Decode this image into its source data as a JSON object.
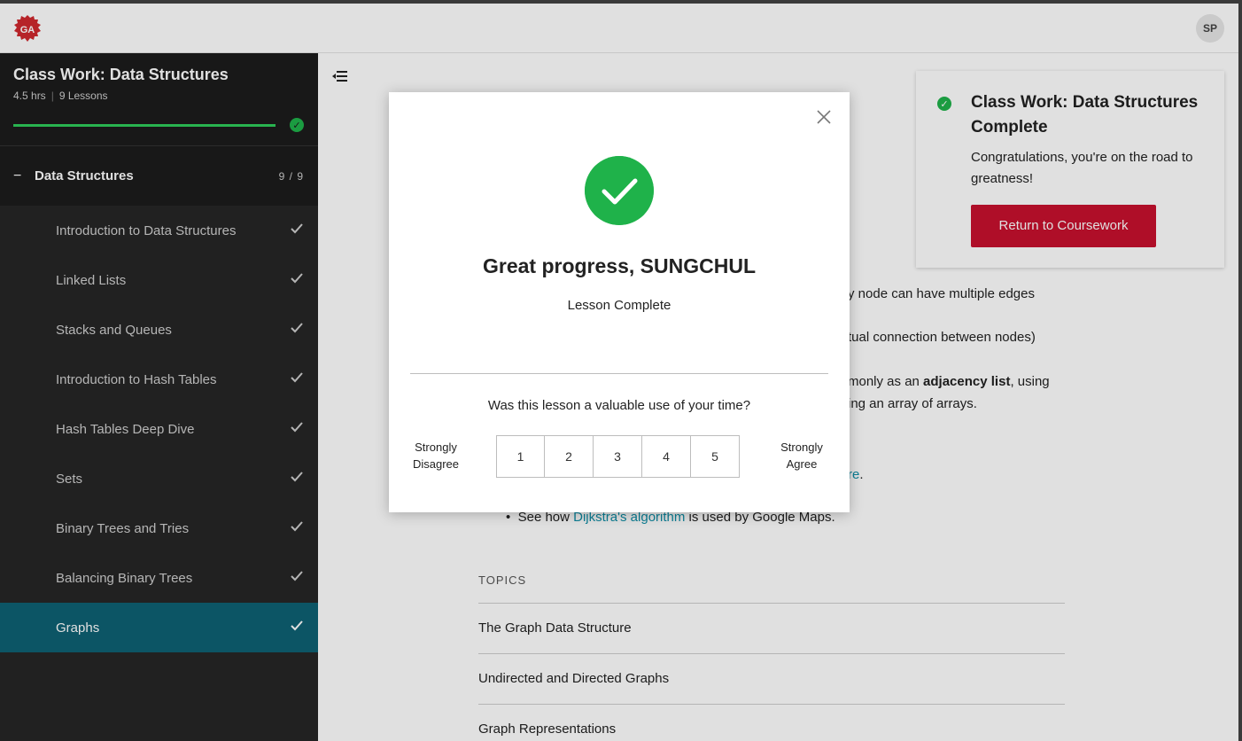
{
  "header": {
    "logo_text": "GA",
    "avatar_initials": "SP"
  },
  "sidebar": {
    "course_title": "Class Work: Data Structures",
    "duration": "4.5 hrs",
    "lesson_count": "9 Lessons",
    "progress": 1.0,
    "section": {
      "toggle": "−",
      "title": "Data Structures",
      "count": "9 / 9"
    },
    "lessons": [
      {
        "label": "Introduction to Data Structures",
        "complete": true
      },
      {
        "label": "Linked Lists",
        "complete": true
      },
      {
        "label": "Stacks and Queues",
        "complete": true
      },
      {
        "label": "Introduction to Hash Tables",
        "complete": true
      },
      {
        "label": "Hash Tables Deep Dive",
        "complete": true
      },
      {
        "label": "Sets",
        "complete": true
      },
      {
        "label": "Binary Trees and Tries",
        "complete": true
      },
      {
        "label": "Balancing Binary Trees",
        "complete": true
      },
      {
        "label": "Graphs",
        "complete": true,
        "active": true
      }
    ]
  },
  "completion_card": {
    "title": "Class Work: Data Structures Complete",
    "message": "Congratulations, you're on the road to greatness!",
    "button_label": "Return to Coursework"
  },
  "content": {
    "line1": "y node can have multiple edges",
    "line2": "tual connection between nodes)",
    "line3_pre": "monly as an ",
    "line3_bold": "adjacency list",
    "line3_post": ", using",
    "line4": "ing an array of arrays.",
    "line5_link": "re",
    "line5_post": ".",
    "bullet_pre": "See how ",
    "bullet_link": "Dijkstra's algorithm",
    "bullet_post": " is used by Google Maps.",
    "topics_label": "TOPICS",
    "topics": [
      "The Graph Data Structure",
      "Undirected and Directed Graphs",
      "Graph Representations"
    ]
  },
  "modal": {
    "title": "Great progress, SUNGCHUL",
    "subtitle": "Lesson Complete",
    "question": "Was this lesson a valuable use of your time?",
    "scale_left": "Strongly Disagree",
    "scale_right": "Strongly Agree",
    "options": [
      "1",
      "2",
      "3",
      "4",
      "5"
    ]
  },
  "colors": {
    "accent_green": "#1fb24a",
    "active_lesson": "#0e6173",
    "brand_red": "#c8102e",
    "link": "#0e8fa8"
  },
  "icons": [
    "ga-logo",
    "check-icon",
    "menu-collapse-icon",
    "close-icon",
    "check-circle-icon"
  ]
}
